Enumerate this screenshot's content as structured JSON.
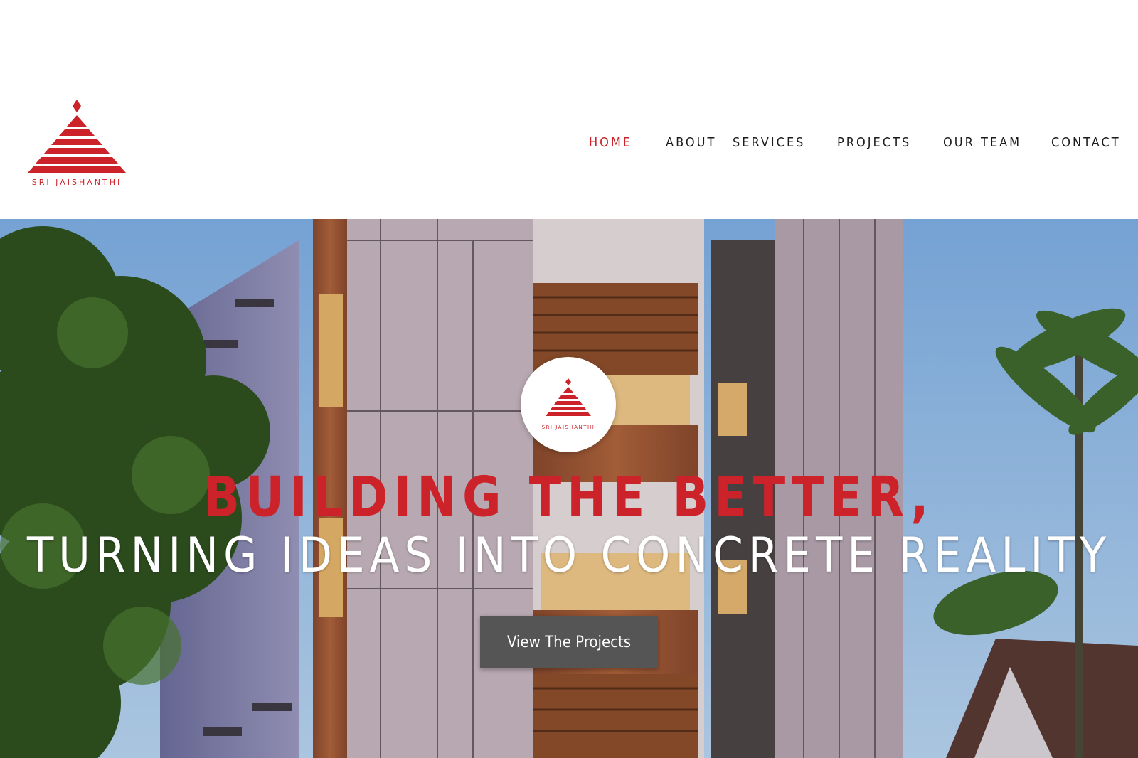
{
  "brand": {
    "name": "SRI JAISHANTHI",
    "accent_color": "#cc2229"
  },
  "nav": {
    "items": [
      {
        "label": "HOME",
        "active": true
      },
      {
        "label": "ABOUT",
        "active": false
      },
      {
        "label": "SERVICES",
        "active": false
      },
      {
        "label": "PROJECTS",
        "active": false
      },
      {
        "label": "OUR TEAM",
        "active": false
      },
      {
        "label": "CONTACT",
        "active": false
      }
    ]
  },
  "hero": {
    "headline": "BUILDING THE BETTER,",
    "subline": "TURNING IDEAS INTO CONCRETE REALITY",
    "cta_label": "View The Projects",
    "badge_text": "SRI JAISHANTHI"
  }
}
